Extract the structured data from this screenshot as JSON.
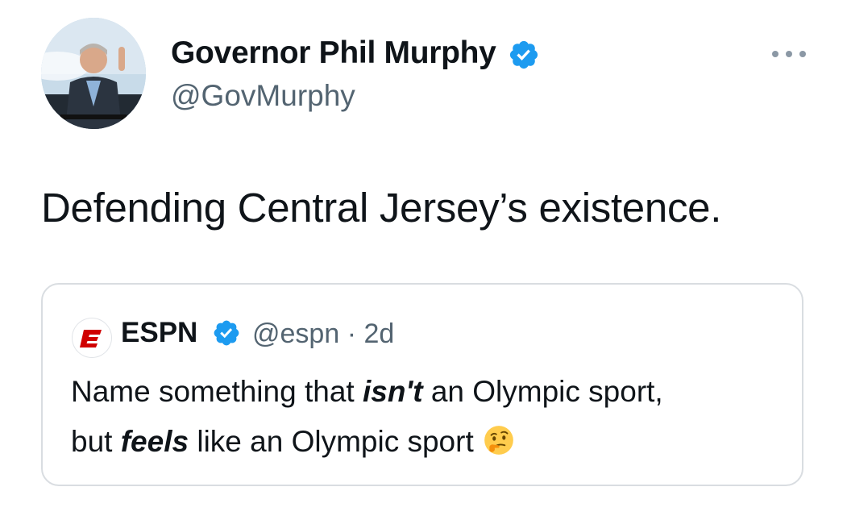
{
  "tweet": {
    "author": {
      "name": "Governor Phil Murphy",
      "handle": "@GovMurphy",
      "verified": true
    },
    "text": "Defending Central Jersey’s existence.",
    "more_icon": "more-horizontal-icon"
  },
  "quoted": {
    "name": "ESPN",
    "handle": "@espn",
    "separator": "·",
    "time": "2d",
    "verified": true,
    "line1": {
      "before": "Name something that ",
      "emph": "isn't",
      "after": " an Olympic sport,"
    },
    "line2": {
      "before": "but ",
      "emph": "feels",
      "after": " like an Olympic sport"
    },
    "emoji": "thinking-face-icon"
  },
  "colors": {
    "verified": "#1d9bf0",
    "text": "#0f1419",
    "secondary": "#536471",
    "border": "#d9dde1",
    "espn_red": "#d00000"
  }
}
